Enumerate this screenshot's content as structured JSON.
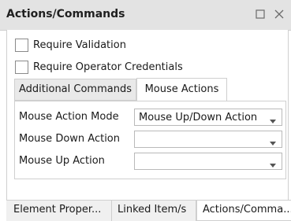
{
  "window": {
    "title": "Actions/Commands",
    "icons": {
      "maximize": "maximize-icon",
      "close": "close-icon"
    }
  },
  "checkboxes": [
    {
      "label": "Require Validation",
      "checked": false
    },
    {
      "label": "Require Operator Credentials",
      "checked": false
    }
  ],
  "tabs": [
    {
      "label": "Additional Commands",
      "active": false
    },
    {
      "label": "Mouse Actions",
      "active": true
    }
  ],
  "mouse_actions": {
    "fields": [
      {
        "label": "Mouse Action Mode",
        "value": "Mouse Up/Down Action"
      },
      {
        "label": "Mouse Down Action",
        "value": ""
      },
      {
        "label": "Mouse Up Action",
        "value": ""
      }
    ]
  },
  "bottom_tabs": [
    {
      "label": "Element Proper...",
      "active": false
    },
    {
      "label": "Linked Item/s",
      "active": false
    },
    {
      "label": "Actions/Comma...",
      "active": true
    }
  ],
  "colors": {
    "titlebar": "#e3e3e3",
    "border": "#cfcfcf",
    "text": "#1a1a1a"
  }
}
